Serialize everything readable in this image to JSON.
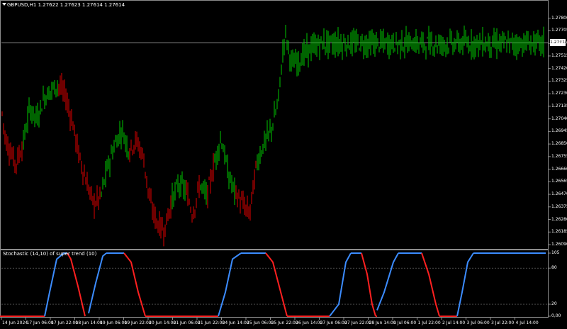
{
  "header": {
    "symbol_info": "GBPUSD,H1  1.27622 1.27623 1.27614 1.27614"
  },
  "indicator": {
    "title": "Stochastic (14,10) of super trend (10)",
    "levels": [
      "105",
      "80",
      "20",
      "0,00"
    ]
  },
  "current_price": "1.27614",
  "colors": {
    "bull": "#00c800",
    "bear": "#e00000",
    "stoch_up": "#3c8cff",
    "stoch_down": "#ff2020",
    "grid": "#8c8c8c"
  },
  "chart_data": [
    {
      "type": "candlestick",
      "title": "GBPUSD,H1",
      "y_ticks": [
        "1.27800",
        "1.27705",
        "1.27610",
        "1.27515",
        "1.27420",
        "1.27325",
        "1.27230",
        "1.27135",
        "1.27040",
        "1.26945",
        "1.26850",
        "1.26755",
        "1.26660",
        "1.26565",
        "1.26470",
        "1.26375",
        "1.26280",
        "1.26185",
        "1.26090"
      ],
      "ylim": [
        1.2609,
        1.27895
      ],
      "x_ticks": [
        "14 Jun 2024",
        "17 Jun 06:00",
        "17 Jun 22:00",
        "18 Jun 14:00",
        "19 Jun 06:00",
        "19 Jun 22:00",
        "20 Jun 14:00",
        "21 Jun 06:00",
        "21 Jun 22:00",
        "24 Jun 14:00",
        "25 Jun 06:00",
        "25 Jun 22:00",
        "26 Jun 14:00",
        "27 Jun 06:00",
        "27 Jun 22:00",
        "28 Jun 14:00",
        "1 Jul 06:00",
        "1 Jul 22:00",
        "2 Jul 14:00",
        "3 Jul 06:00",
        "3 Jul 22:00",
        "4 Jul 14:00"
      ],
      "trend_path": [
        [
          0,
          1.2712,
          -1
        ],
        [
          6,
          1.2688,
          -1
        ],
        [
          14,
          1.2678,
          -1
        ],
        [
          20,
          1.267,
          -1
        ],
        [
          30,
          1.2684,
          1
        ],
        [
          40,
          1.2712,
          1
        ],
        [
          50,
          1.2704,
          1
        ],
        [
          60,
          1.272,
          1
        ],
        [
          70,
          1.2726,
          1
        ],
        [
          80,
          1.273,
          -1
        ],
        [
          90,
          1.2722,
          -1
        ],
        [
          100,
          1.2702,
          -1
        ],
        [
          110,
          1.2675,
          -1
        ],
        [
          120,
          1.2656,
          -1
        ],
        [
          130,
          1.264,
          -1
        ],
        [
          140,
          1.2645,
          1
        ],
        [
          150,
          1.2668,
          1
        ],
        [
          160,
          1.2685,
          1
        ],
        [
          170,
          1.2696,
          1
        ],
        [
          180,
          1.268,
          -1
        ],
        [
          190,
          1.2688,
          -1
        ],
        [
          200,
          1.2676,
          -1
        ],
        [
          210,
          1.264,
          -1
        ],
        [
          220,
          1.2625,
          -1
        ],
        [
          230,
          1.262,
          -1
        ],
        [
          240,
          1.2642,
          1
        ],
        [
          250,
          1.2655,
          1
        ],
        [
          260,
          1.265,
          -1
        ],
        [
          270,
          1.2632,
          -1
        ],
        [
          280,
          1.2655,
          1
        ],
        [
          290,
          1.2645,
          -1
        ],
        [
          300,
          1.267,
          1
        ],
        [
          310,
          1.269,
          1
        ],
        [
          320,
          1.2662,
          1
        ],
        [
          330,
          1.2648,
          -1
        ],
        [
          340,
          1.264,
          -1
        ],
        [
          350,
          1.2632,
          -1
        ],
        [
          360,
          1.267,
          1
        ],
        [
          370,
          1.2685,
          1
        ],
        [
          380,
          1.2695,
          1
        ],
        [
          390,
          1.2715,
          1
        ],
        [
          400,
          1.277,
          1
        ],
        [
          410,
          1.2745,
          1
        ],
        [
          420,
          1.2748,
          1
        ],
        [
          430,
          1.2755,
          1
        ],
        [
          440,
          1.2758,
          1
        ],
        [
          450,
          1.2761,
          1
        ]
      ]
    },
    {
      "type": "line",
      "title": "Stochastic (14,10) of super trend (10)",
      "ylim": [
        0,
        105
      ],
      "levels": [
        0,
        20,
        80,
        105
      ],
      "segments": [
        {
          "dir": "up",
          "x": [
            63,
            70,
            80,
            90
          ],
          "y": [
            0,
            40,
            95,
            105
          ]
        },
        {
          "dir": "down",
          "x": [
            95,
            100,
            110,
            120
          ],
          "y": [
            105,
            95,
            50,
            0
          ]
        },
        {
          "dir": "up",
          "x": [
            125,
            135,
            145,
            150
          ],
          "y": [
            5,
            55,
            100,
            105
          ]
        },
        {
          "dir": "down",
          "x": [
            175,
            185,
            195,
            205
          ],
          "y": [
            105,
            90,
            40,
            0
          ]
        },
        {
          "dir": "up",
          "x": [
            308,
            318,
            328,
            340
          ],
          "y": [
            0,
            40,
            95,
            105
          ]
        },
        {
          "dir": "down",
          "x": [
            375,
            385,
            395,
            405
          ],
          "y": [
            105,
            90,
            45,
            0
          ]
        },
        {
          "dir": "up",
          "x": [
            465,
            478,
            488,
            495
          ],
          "y": [
            0,
            20,
            90,
            105
          ]
        },
        {
          "dir": "down",
          "x": [
            510,
            518,
            525,
            530
          ],
          "y": [
            105,
            70,
            20,
            0
          ]
        },
        {
          "dir": "up",
          "x": [
            532,
            542,
            555,
            562
          ],
          "y": [
            10,
            40,
            90,
            105
          ]
        },
        {
          "dir": "down",
          "x": [
            595,
            605,
            615,
            620
          ],
          "y": [
            105,
            70,
            20,
            0
          ]
        },
        {
          "dir": "up",
          "x": [
            645,
            652,
            660,
            668
          ],
          "y": [
            0,
            40,
            90,
            105
          ]
        }
      ],
      "flat_top": [
        [
          90,
          95
        ],
        [
          150,
          175
        ],
        [
          340,
          375
        ],
        [
          495,
          510
        ],
        [
          562,
          595
        ],
        [
          668,
          770
        ]
      ],
      "flat_bottom": [
        [
          0,
          63
        ],
        [
          205,
          308
        ],
        [
          405,
          465
        ],
        [
          530,
          532
        ],
        [
          620,
          645
        ]
      ]
    }
  ]
}
